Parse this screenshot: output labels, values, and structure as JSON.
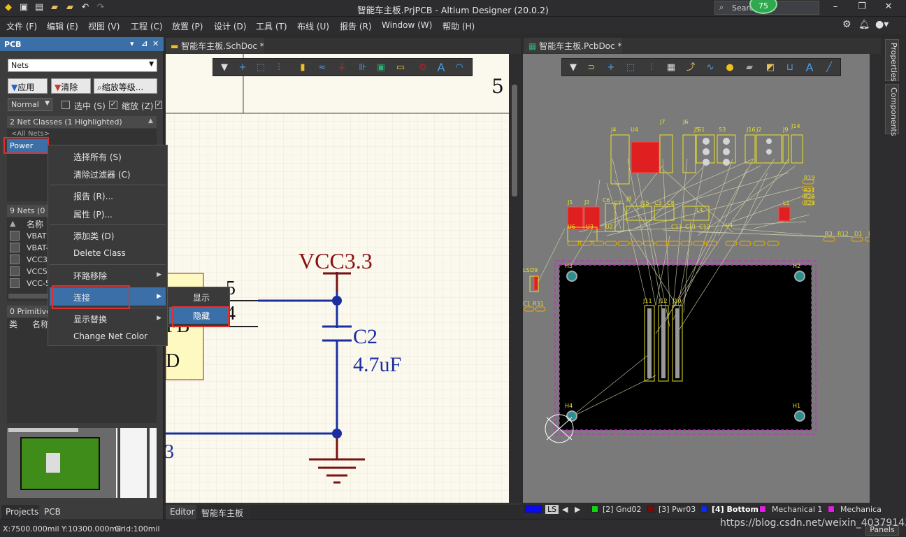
{
  "window": {
    "title": "智能车主板.PrjPCB - Altium Designer (20.0.2)",
    "search_placeholder": "Search",
    "notification_count": "75"
  },
  "menus": [
    "文件 (F)",
    "编辑 (E)",
    "视图 (V)",
    "工程 (C)",
    "放置 (P)",
    "设计 (D)",
    "工具 (T)",
    "布线 (U)",
    "报告 (R)",
    "Window (W)",
    "帮助 (H)"
  ],
  "pcb_panel": {
    "title": "PCB",
    "mode_select": "Nets",
    "apply_button": "应用",
    "clear_button": "清除",
    "zoom_level_button": "缩放等级...",
    "mask_mode": "Normal",
    "select_label": "选中 (S)",
    "select_checked": false,
    "zoom_label": "缩放 (Z)",
    "zoom_checked": true,
    "net_classes_header": "2 Net Classes (1 Highlighted)",
    "net_classes": [
      "<All Nets>",
      "Power"
    ],
    "nets_header": "9 Nets (0 H",
    "nets_name_col": "名称",
    "nets": [
      "VBAT",
      "VBAT-",
      "VCC3.",
      "VCC5",
      "VCC-5"
    ],
    "primitives_header": "0 Primitives",
    "primitives_cols": [
      "类",
      "名称"
    ]
  },
  "context_menu": {
    "items": [
      "选择所有 (S)",
      "清除过滤器 (C)",
      "报告 (R)...",
      "属性 (P)...",
      "添加类 (D)",
      "Delete Class",
      "环路移除",
      "连接",
      "显示替换",
      "Change Net Color"
    ],
    "highlighted": "连接",
    "submenu": [
      "显示",
      "隐藏"
    ],
    "submenu_highlighted": "隐藏"
  },
  "bottom_left_tabs": [
    "Projects",
    "PCB"
  ],
  "sch": {
    "tab": "智能车主板.SchDoc *",
    "border_number": "5",
    "net_label": "VCC3.3",
    "cap_ref": "C2",
    "cap_value": "4.7uF",
    "pin5": "5",
    "pin4": "4",
    "frag_fb": "FB",
    "frag_d": "D",
    "frag_3": "3",
    "editor_tab": "Editor",
    "doc_tab": "智能车主板"
  },
  "pcb": {
    "tab": "智能车主板.PcbDoc *",
    "designators": [
      "J4",
      "U4",
      "J7",
      "J6",
      "J5",
      "S1",
      "S3",
      "J16",
      "J2",
      "J9",
      "J14",
      "R19",
      "R21",
      "R26",
      "R28",
      "J1",
      "J2",
      "C6",
      "C7",
      "J8",
      "J15",
      "C3",
      "C8",
      "L4",
      "L1",
      "U6",
      "U3",
      "U2",
      "C13",
      "C11",
      "C12",
      "U1",
      "R3",
      "R12",
      "D1",
      "R1",
      "H3",
      "H2",
      "H4",
      "H1",
      "J11",
      "J12",
      "J10",
      "LS",
      "D9",
      "C1",
      "R31"
    ]
  },
  "layers": {
    "ls_label": "LS",
    "items": [
      {
        "name": "[2] Gnd02",
        "color": "#12d612"
      },
      {
        "name": "[3] Pwr03",
        "color": "#7a0a0a"
      },
      {
        "name": "[4] Bottom",
        "color": "#0a2af0"
      },
      {
        "name": "Mechanical 1",
        "color": "#e01ee0"
      },
      {
        "name": "Mechanica",
        "color": "#e01ee0"
      }
    ],
    "current_color": "#0a0af0"
  },
  "right_tabs": [
    "Properties",
    "Components"
  ],
  "status": {
    "coords": "X:7500.000mil Y:10300.000mil",
    "grid": "Grid:100mil",
    "panels_button": "Panels"
  },
  "watermark": "https://blog.csdn.net/weixin_40379143"
}
